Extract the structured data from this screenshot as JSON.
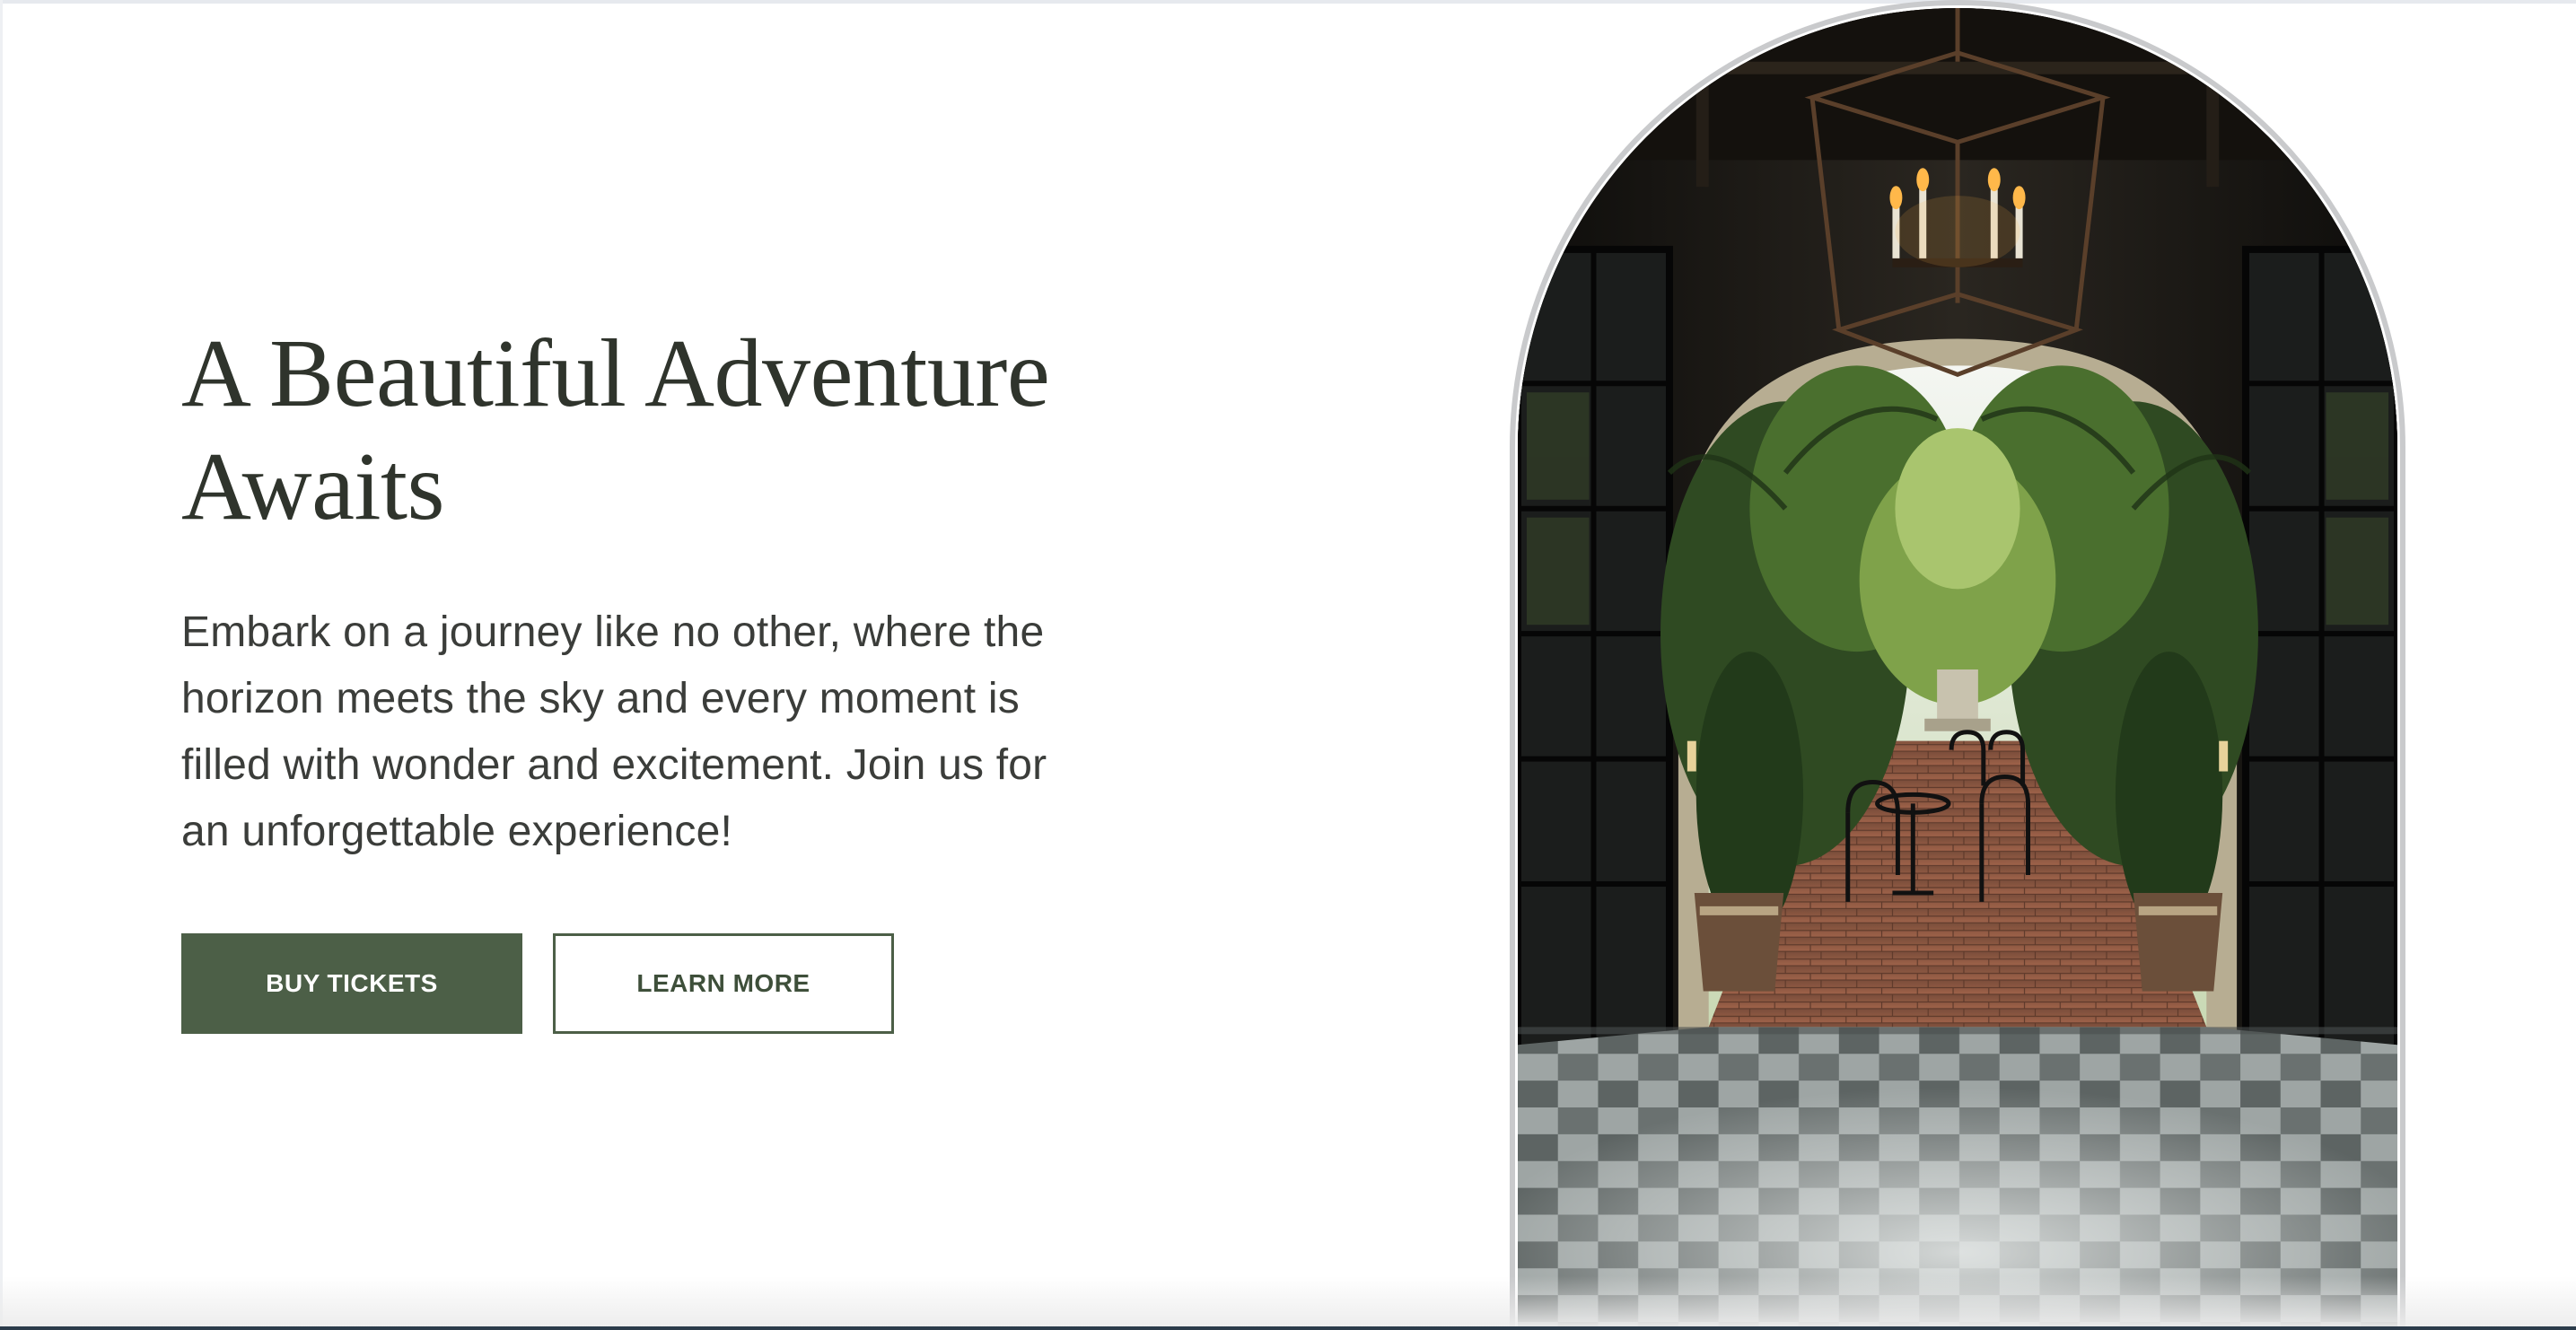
{
  "hero": {
    "title_line1": "A Beautiful Adventure",
    "title_line2": "Awaits",
    "description": "Embark on a journey like no other, where the horizon meets the sky and every moment is filled with wonder and excitement. Join us for an unforgettable experience!",
    "buttons": {
      "primary_label": "BUY TICKETS",
      "secondary_label": "LEARN MORE"
    }
  },
  "colors": {
    "accent": "#4c5f47",
    "heading": "#2f342c",
    "body_text": "#3b3d3a",
    "background": "#ffffff"
  }
}
